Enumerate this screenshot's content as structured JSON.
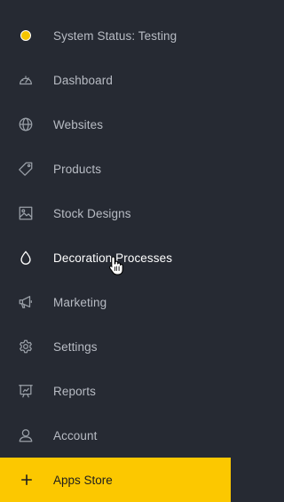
{
  "sidebar": {
    "items": [
      {
        "label": "System Status: Testing",
        "icon": "status-dot-icon"
      },
      {
        "label": "Dashboard",
        "icon": "speedometer-icon"
      },
      {
        "label": "Websites",
        "icon": "globe-icon"
      },
      {
        "label": "Products",
        "icon": "tag-icon"
      },
      {
        "label": "Stock Designs",
        "icon": "image-icon"
      },
      {
        "label": "Decoration Processes",
        "icon": "droplet-icon"
      },
      {
        "label": "Marketing",
        "icon": "megaphone-icon"
      },
      {
        "label": "Settings",
        "icon": "gear-icon"
      },
      {
        "label": "Reports",
        "icon": "presentation-icon"
      },
      {
        "label": "Account",
        "icon": "user-icon"
      }
    ],
    "apps_store": {
      "label": "Apps Store",
      "icon": "plus-icon"
    },
    "active_item": "Decoration Processes"
  },
  "colors": {
    "background": "#262a33",
    "label": "#b8bcc4",
    "label_active": "#ffffff",
    "status_dot": "#f5c400",
    "apps_store_bg": "#fcc800"
  }
}
